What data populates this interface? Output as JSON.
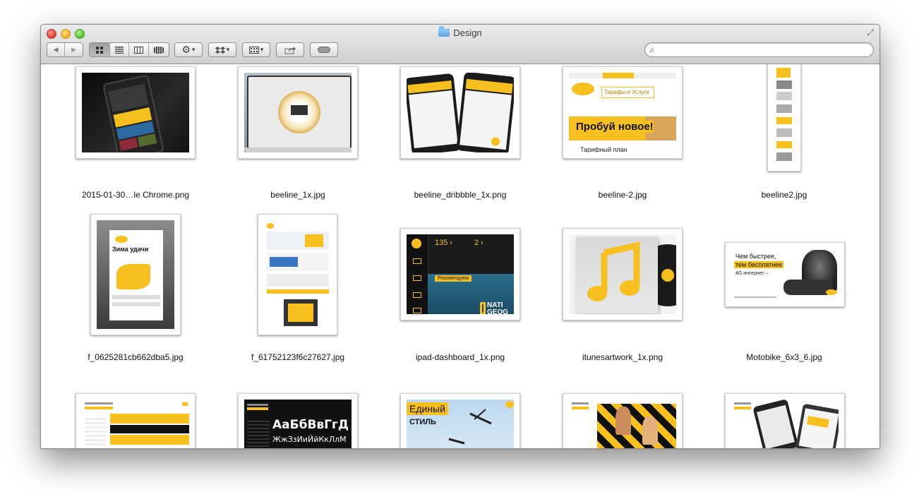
{
  "window": {
    "title": "Design"
  },
  "toolbar": {
    "back": "◀",
    "forward": "▶",
    "views": [
      "icon-view",
      "list-view",
      "column-view",
      "coverflow-view"
    ],
    "action_icon": "gear-icon",
    "dropbox_icon": "dropbox-icon",
    "arrange_icon": "arrange-icon",
    "share_icon": "share-icon",
    "tags_icon": "tags-icon",
    "chevron": "▾"
  },
  "search": {
    "placeholder": "",
    "value": ""
  },
  "files": [
    {
      "name": "2015-01-30…le Chrome.png"
    },
    {
      "name": "beeline_1x.jpg"
    },
    {
      "name": "beeline_dribbble_1x.png"
    },
    {
      "name": "beeline-2.jpg"
    },
    {
      "name": "beeline2.jpg"
    },
    {
      "name": "f_0625281cb662dba5.jpg"
    },
    {
      "name": "f_61752123f6c27627.jpg"
    },
    {
      "name": "ipad-dashboard_1x.png"
    },
    {
      "name": "itunesartwork_1x.png"
    },
    {
      "name": "Motobike_6x3_6.jpg"
    },
    {
      "name": ""
    },
    {
      "name": ""
    },
    {
      "name": ""
    },
    {
      "name": ""
    },
    {
      "name": ""
    }
  ],
  "thumb_text": {
    "beeline2_headline": "Пробуй новое!",
    "beeline2_tab": "Тарифы и Услуги",
    "beeline2_sub": "Тарифный план",
    "f06_title": "Зима удачи",
    "ipad_num1": "135 ›",
    "ipad_num2": "2 ›",
    "ipad_btn": "Рекомендуем",
    "ipad_nat": "NATI GEOG",
    "moto_line1": "Чем быстрее,",
    "moto_line2": "тем бесплатнее",
    "moto_line3": "4G интернет –",
    "font_specimen_1": "АаБбВвГгД",
    "font_specimen_2": "ЖжЗзИиЙйКкЛлМ",
    "edin_1": "Единый",
    "edin_2": "СТИЛЬ"
  },
  "colors": {
    "beeline_yellow": "#f7c01f",
    "dark": "#1a1a1a"
  }
}
